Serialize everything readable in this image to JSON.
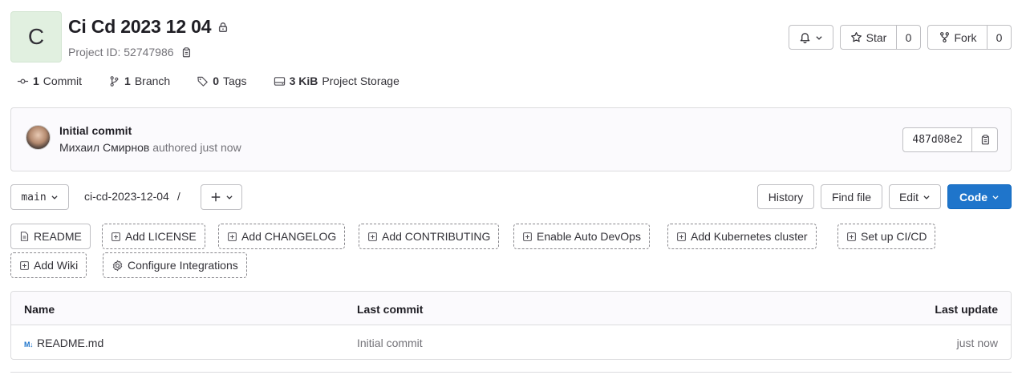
{
  "project": {
    "avatar_letter": "C",
    "title": "Ci Cd 2023 12 04",
    "id_label": "Project ID: 52747986"
  },
  "header_actions": {
    "star_label": "Star",
    "star_count": "0",
    "fork_label": "Fork",
    "fork_count": "0"
  },
  "stats": [
    {
      "count": "1",
      "label": "Commit"
    },
    {
      "count": "1",
      "label": "Branch"
    },
    {
      "count": "0",
      "label": "Tags"
    },
    {
      "count": "3 KiB",
      "label": "Project Storage"
    }
  ],
  "last_commit": {
    "title": "Initial commit",
    "author": "Михаил Смирнов",
    "meta": "authored just now",
    "sha": "487d08e2"
  },
  "repo_nav": {
    "branch": "main",
    "path": "ci-cd-2023-12-04",
    "separator": "/",
    "history": "History",
    "find_file": "Find file",
    "edit": "Edit",
    "code": "Code"
  },
  "suggestions": [
    {
      "label": "README",
      "icon": "file-icon",
      "style": "solid"
    },
    {
      "label": "Add LICENSE",
      "icon": "plus-square-icon",
      "style": "dashed"
    },
    {
      "label": "Add CHANGELOG",
      "icon": "plus-square-icon",
      "style": "dashed"
    },
    {
      "label": "Add CONTRIBUTING",
      "icon": "plus-square-icon",
      "style": "dashed"
    },
    {
      "label": "Enable Auto DevOps",
      "icon": "plus-square-icon",
      "style": "dashed"
    },
    {
      "label": "Add Kubernetes cluster",
      "icon": "plus-square-icon",
      "style": "dashed"
    },
    {
      "label": "Set up CI/CD",
      "icon": "plus-square-icon",
      "style": "dashed"
    },
    {
      "label": "Add Wiki",
      "icon": "plus-square-icon",
      "style": "dashed"
    },
    {
      "label": "Configure Integrations",
      "icon": "settings-icon",
      "style": "dashed"
    }
  ],
  "file_table": {
    "columns": [
      "Name",
      "Last commit",
      "Last update"
    ],
    "rows": [
      {
        "icon": "markdown-icon",
        "icon_text": "M↓",
        "name": "README.md",
        "last_commit": "Initial commit",
        "last_update": "just now"
      }
    ]
  },
  "colors": {
    "primary": "#1f75cb",
    "text": "#333238",
    "muted": "#737278",
    "border": "#dcdcde"
  }
}
